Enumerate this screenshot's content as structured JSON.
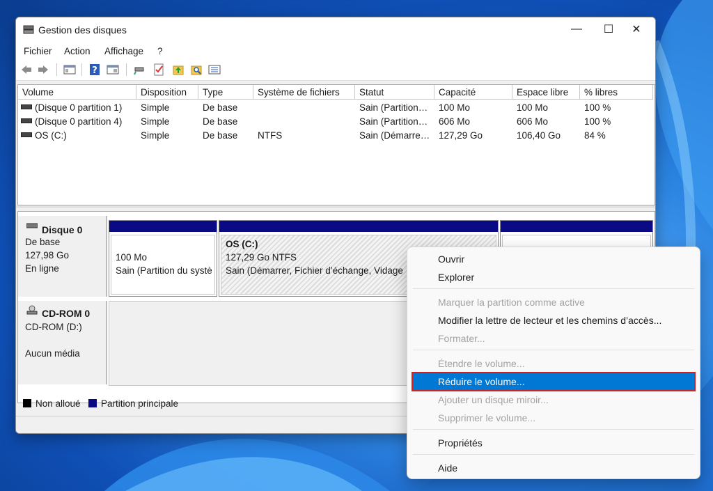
{
  "window": {
    "title": "Gestion des disques",
    "controls": {
      "minimize": "—",
      "maximize": "☐",
      "close": "✕"
    }
  },
  "menu": [
    "Fichier",
    "Action",
    "Affichage",
    "?"
  ],
  "toolbar_icons": [
    "back-icon",
    "forward-icon",
    "console-tree-icon",
    "help-icon",
    "properties-icon",
    "connect-icon",
    "check-icon",
    "up-folder-icon",
    "search-folder-icon",
    "list-icon"
  ],
  "volume_table": {
    "columns": [
      "Volume",
      "Disposition",
      "Type",
      "Système de fichiers",
      "Statut",
      "Capacité",
      "Espace libre",
      "% libres"
    ],
    "rows": [
      [
        "(Disque 0 partition 1)",
        "Simple",
        "De base",
        "",
        "Sain (Partition…",
        "100 Mo",
        "100 Mo",
        "100 %"
      ],
      [
        "(Disque 0 partition 4)",
        "Simple",
        "De base",
        "",
        "Sain (Partition…",
        "606 Mo",
        "606 Mo",
        "100 %"
      ],
      [
        "OS (C:)",
        "Simple",
        "De base",
        "NTFS",
        "Sain (Démarre…",
        "127,29 Go",
        "106,40 Go",
        "84 %"
      ]
    ]
  },
  "disks": [
    {
      "name": "Disque 0",
      "type": "De base",
      "size": "127,98 Go",
      "state": "En ligne",
      "partitions": [
        {
          "title": "",
          "line1": "100 Mo",
          "line2": "Sain (Partition du systè"
        },
        {
          "title": "OS  (C:)",
          "line1": "127,29 Go NTFS",
          "line2": "Sain (Démarrer, Fichier d’échange, Vidage"
        },
        {
          "title": "",
          "line1": "",
          "line2": ""
        }
      ]
    },
    {
      "name": "CD-ROM 0",
      "type": "CD-ROM (D:)",
      "state": "Aucun média"
    }
  ],
  "legend": [
    {
      "label": "Non alloué",
      "color": "#000000"
    },
    {
      "label": "Partition principale",
      "color": "#0a0a84"
    }
  ],
  "context_menu": {
    "items": [
      {
        "label": "Ouvrir",
        "enabled": true
      },
      {
        "label": "Explorer",
        "enabled": true
      },
      {
        "label": "Marquer la partition comme active",
        "enabled": false
      },
      {
        "label": "Modifier la lettre de lecteur et les chemins d’accès...",
        "enabled": true
      },
      {
        "label": "Formater...",
        "enabled": false
      },
      {
        "label": "Étendre le volume...",
        "enabled": false
      },
      {
        "label": "Réduire le volume...",
        "enabled": true,
        "highlighted": true
      },
      {
        "label": "Ajouter un disque miroir...",
        "enabled": false
      },
      {
        "label": "Supprimer le volume...",
        "enabled": false
      },
      {
        "label": "Propriétés",
        "enabled": true
      },
      {
        "label": "Aide",
        "enabled": true
      }
    ]
  },
  "colors": {
    "accent": "#0078d4",
    "highlight_border": "#d32020",
    "partition_bar": "#0a0a84"
  }
}
